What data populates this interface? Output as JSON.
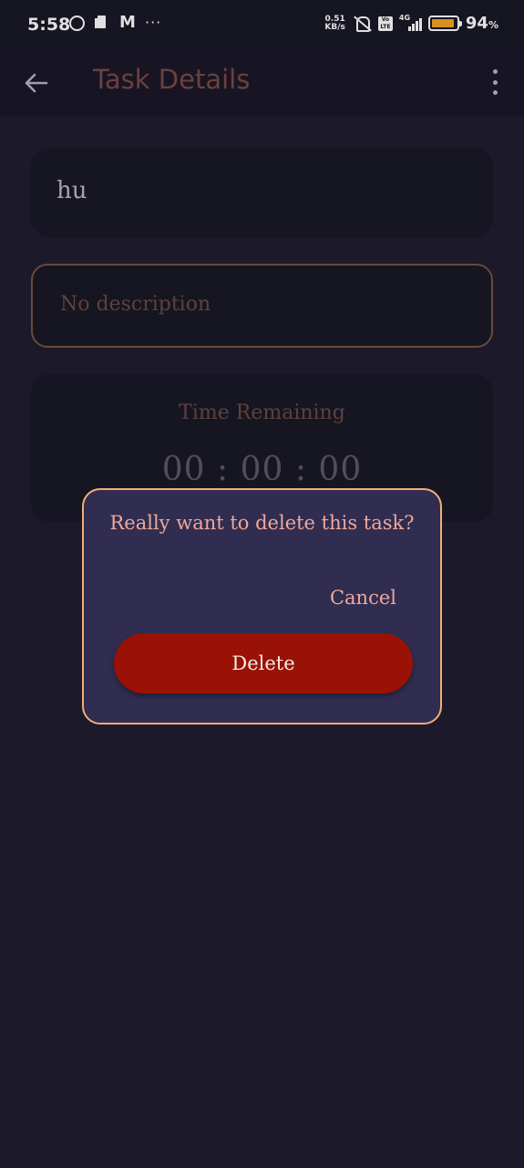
{
  "status_bar": {
    "time": "5:58",
    "net_speed_value": "0.51",
    "net_speed_unit": "KB/s",
    "volte_label_top": "Vo",
    "volte_label_bottom": "LTE",
    "network_type": "4G",
    "battery_percent_value": "94",
    "battery_percent_sign": "%",
    "battery_level": 0.94,
    "battery_color": "#f5a623"
  },
  "app_bar": {
    "title": "Task Details",
    "back_icon": "arrow-left-icon",
    "menu_icon": "more-vert-icon"
  },
  "task": {
    "title": "hu",
    "description": "No description",
    "timer_label": "Time Remaining",
    "timer_value": "00 : 00 : 00"
  },
  "dialog": {
    "message": "Really want to delete this task?",
    "cancel_label": "Cancel",
    "delete_label": "Delete",
    "accent_color": "#f2ad77",
    "delete_color": "#9a1205"
  }
}
